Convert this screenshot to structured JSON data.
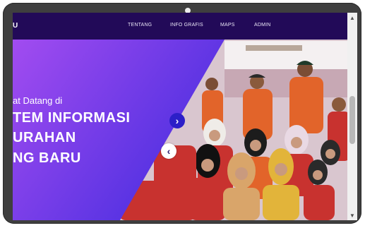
{
  "navbar": {
    "brand": "U",
    "items": [
      {
        "label": "TENTANG"
      },
      {
        "label": "INFO GRAFIS"
      },
      {
        "label": "MAPS"
      },
      {
        "label": "ADMIN"
      }
    ]
  },
  "hero": {
    "welcome": "at Datang di",
    "title_lines": [
      "TEM INFORMASI",
      "URAHAN",
      "NG BARU"
    ],
    "next_arrow": "›",
    "prev_arrow": "‹"
  },
  "scrollbar": {
    "up": "▲",
    "down": "▼"
  },
  "colors": {
    "navbar": "#220a58",
    "hero_gradient_start": "#a24cf0",
    "hero_gradient_end": "#4a2ee0",
    "accent_arrow": "#2c1fc8",
    "jacket_orange": "#e2642a",
    "jacket_red": "#c8322f"
  }
}
